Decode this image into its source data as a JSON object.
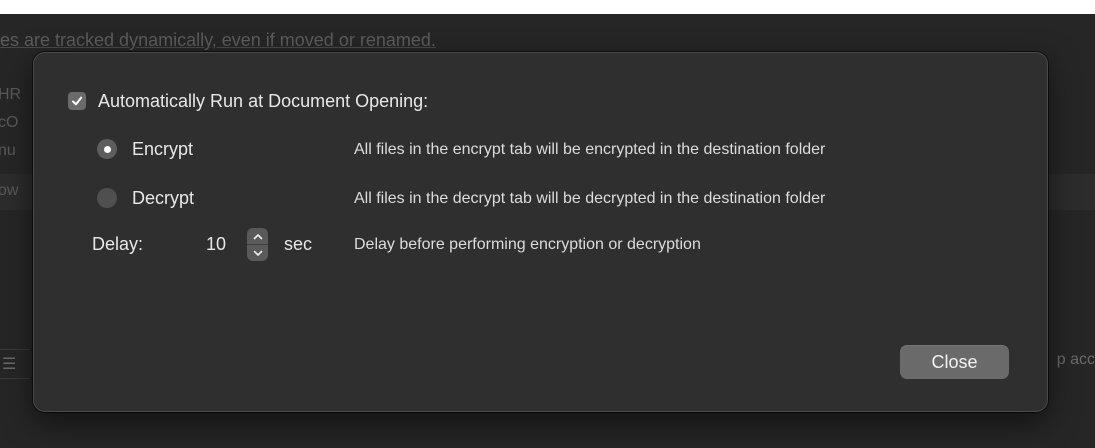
{
  "background": {
    "top_text": "es are tracked dynamically, even if moved or renamed.",
    "left_fragments": [
      "HR",
      "cO",
      "nu",
      "ow"
    ],
    "right_fragment": "p acc",
    "bottom_left_glyph": "☰"
  },
  "dialog": {
    "auto_run": {
      "checked": true,
      "label": "Automatically Run at Document Opening:"
    },
    "options": [
      {
        "label": "Encrypt",
        "selected": true,
        "description": "All files in the encrypt tab will be encrypted in the destination folder"
      },
      {
        "label": "Decrypt",
        "selected": false,
        "description": "All files in the decrypt tab will be decrypted in the destination folder"
      }
    ],
    "delay": {
      "label": "Delay:",
      "value": "10",
      "unit": "sec",
      "description": "Delay before performing encryption or decryption"
    },
    "close_label": "Close"
  },
  "colors": {
    "backdrop": "#262626",
    "dialog_bg": "#2f2f2f",
    "button_bg": "#6a6a6a",
    "text": "#e8e8e8"
  },
  "icons": {
    "checkbox": "checkmark-icon",
    "stepper_up": "chevron-up-icon",
    "stepper_down": "chevron-down-icon"
  }
}
